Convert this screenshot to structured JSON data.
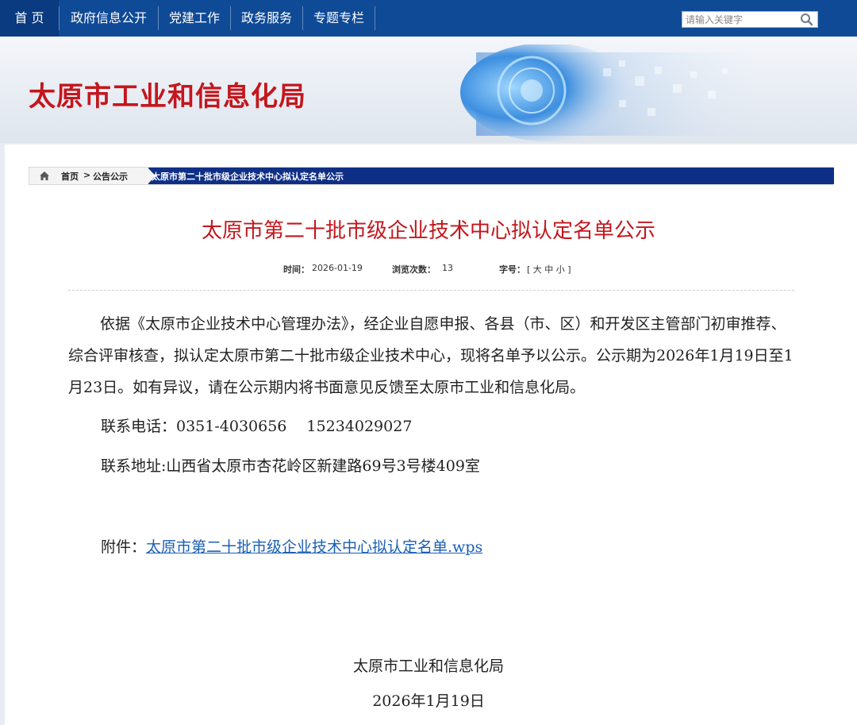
{
  "nav": {
    "items": [
      "首 页",
      "政府信息公开",
      "党建工作",
      "政务服务",
      "专题专栏"
    ],
    "search_placeholder": "请输入关键字"
  },
  "banner": {
    "title": "太原市工业和信息化局"
  },
  "breadcrumb": {
    "home": "首页",
    "separator": ">",
    "section": "公告公示",
    "current": "太原市第二十批市级企业技术中心拟认定名单公示"
  },
  "article": {
    "title": "太原市第二十批市级企业技术中心拟认定名单公示",
    "time_label": "时间：",
    "time_value": "2026-01-19",
    "views_label": "浏览次数：",
    "views_value": "13",
    "fontsize_label": "字号：",
    "fontsize_open": "[",
    "fontsize_large": "大",
    "fontsize_medium": "中",
    "fontsize_small": "小",
    "fontsize_close": "]",
    "paragraph": "依据《太原市企业技术中心管理办法》，经企业自愿申报、各县（市、区）和开发区主管部门初审推荐、综合评审核查，拟认定太原市第二十批市级企业技术中心，现将名单予以公示。公示期为2026年1月19日至1月23日。如有异议，请在公示期内将书面意见反馈至太原市工业和信息化局。",
    "phone": "联系电话：0351-4030656　 15234029027",
    "address": "联系地址:山西省太原市杏花岭区新建路69号3号楼409室",
    "attachment_label": "附件：",
    "attachment_link": "太原市第二十批市级企业技术中心拟认定名单.wps",
    "sign_org": "太原市工业和信息化局",
    "sign_date": "2026年1月19日"
  },
  "colors": {
    "nav_bg": "#0f4a97",
    "title_red": "#c4161c",
    "crumb_blue": "#0f2f86",
    "link_blue": "#1a5fb4"
  },
  "icons": [
    "search-icon",
    "home-icon"
  ]
}
